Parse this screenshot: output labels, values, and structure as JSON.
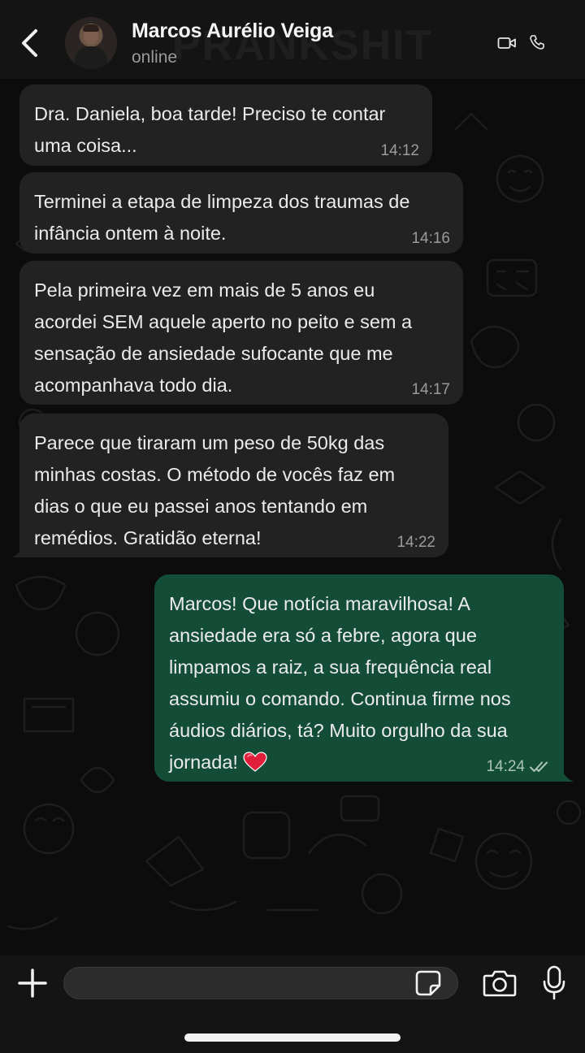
{
  "header": {
    "contact_name": "Marcos Aurélio Veiga",
    "status": "online"
  },
  "watermark": "PRANKSHIT",
  "messages": [
    {
      "direction": "in",
      "text": "Dra. Daniela, boa tarde! Preciso te contar\numa coisa...",
      "time": "14:12"
    },
    {
      "direction": "in",
      "text": "Terminei a etapa de limpeza dos traumas de\ninfância ontem à noite.",
      "time": "14:16"
    },
    {
      "direction": "in",
      "text": "Pela primeira vez em mais de 5 anos eu\nacordei SEM aquele aperto no peito e sem a\nsensação de ansiedade sufocante que me\nacompanhava todo dia.",
      "time": "14:17"
    },
    {
      "direction": "in",
      "text": "Parece que tiraram um peso de 50kg das\nminhas costas. O método de vocês faz em\ndias o que eu passei anos tentando em\nremédios. Gratidão eterna!",
      "time": "14:22"
    },
    {
      "direction": "out",
      "text": "Marcos! Que notícia maravilhosa! A\nansiedade era só a febre, agora que\nlimpamos a raiz, a sua frequência real\nassumiu o comando. Continua firme nos\náudios diários, tá? Muito orgulho da sua\njornada! ",
      "time": "14:24",
      "status": "read"
    }
  ],
  "composer": {
    "placeholder": ""
  },
  "colors": {
    "incoming_bubble": "#222223",
    "outgoing_bubble": "#144d37",
    "background": "#0c0c0d",
    "heart": "#e0203a"
  }
}
